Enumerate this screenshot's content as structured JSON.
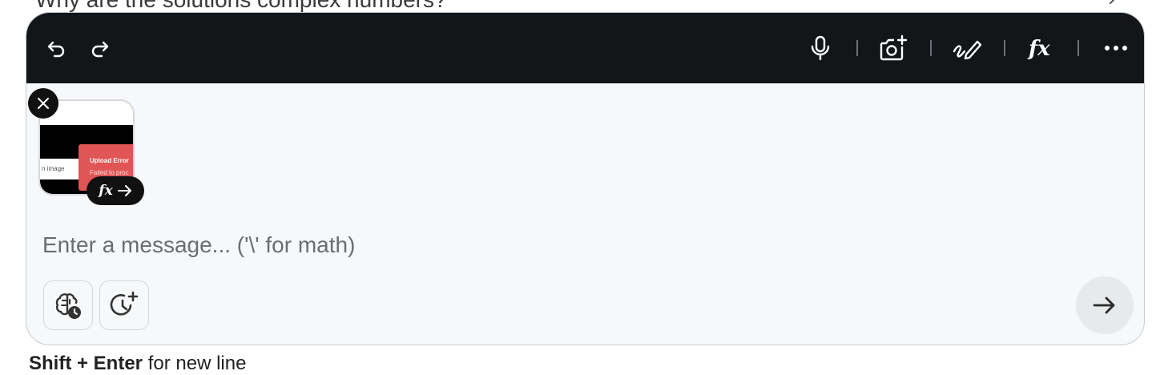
{
  "background": {
    "previous_question": "Why are the solutions complex numbers?",
    "hint_key": "Shift + Enter",
    "hint_suffix": " for new line"
  },
  "toolbar": {
    "undo_icon": "undo-icon",
    "redo_icon": "redo-icon",
    "mic_icon": "microphone-icon",
    "camera_icon": "camera-add-icon",
    "draw_icon": "pen-draw-icon",
    "fx_icon": "fx-icon",
    "more_icon": "more-horizontal-icon"
  },
  "attachment": {
    "thumb_caption": "n image",
    "error_title": "Upload Error",
    "error_message": "Failed to proc",
    "action_label": "fx"
  },
  "composer": {
    "placeholder": "Enter a message... ('\\' for math)",
    "value": ""
  },
  "colors": {
    "toolbar_bg": "#131619",
    "panel_bg": "#f7f8fa",
    "error_red": "#e05555",
    "send_bg": "#e8e9eb"
  }
}
